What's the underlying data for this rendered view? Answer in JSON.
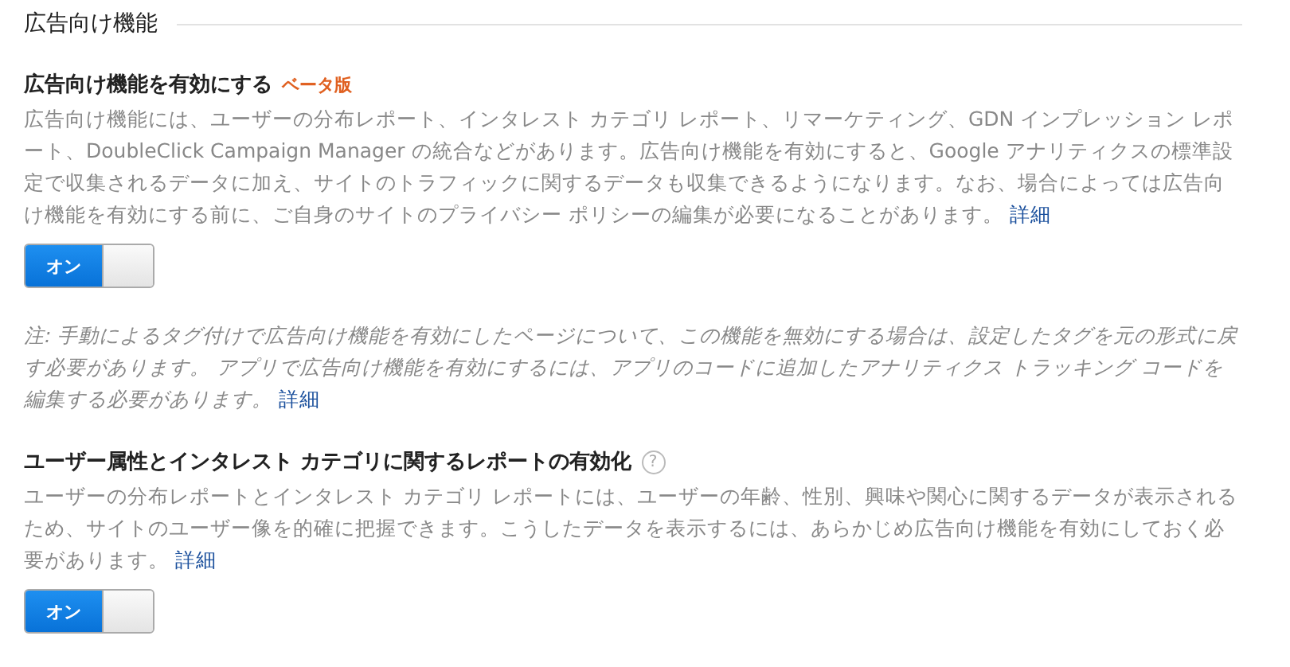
{
  "section": {
    "title": "広告向け機能"
  },
  "items": [
    {
      "kind": "setting",
      "title": "広告向け機能を有効にする",
      "badge": "ベータ版",
      "description": "広告向け機能には、ユーザーの分布レポート、インタレスト カテゴリ レポート、リマーケティング、GDN インプレッション レポート、DoubleClick Campaign Manager の統合などがあります。広告向け機能を有効にすると、Google アナリティクスの標準設定で収集されるデータに加え、サイトのトラフィックに関するデータも収集できるようになります。なお、場合によっては広告向け機能を有効にする前に、ご自身のサイトのプライバシー ポリシーの編集が必要になることがあります。",
      "link": "詳細",
      "toggle": {
        "label": "オン",
        "on": true
      }
    },
    {
      "kind": "note",
      "description": "注: 手動によるタグ付けで広告向け機能を有効にしたページについて、この機能を無効にする場合は、設定したタグを元の形式に戻す必要があります。 アプリで広告向け機能を有効にするには、アプリのコードに追加したアナリティクス トラッキング コードを編集する必要があります。",
      "link": "詳細"
    },
    {
      "kind": "setting",
      "title": "ユーザー属性とインタレスト カテゴリに関するレポートの有効化",
      "help": "?",
      "description": "ユーザーの分布レポートとインタレスト カテゴリ レポートには、ユーザーの年齢、性別、興味や関心に関するデータが表示されるため、サイトのユーザー像を的確に把握できます。こうしたデータを表示するには、あらかじめ広告向け機能を有効にしておく必要があります。",
      "link": "詳細",
      "toggle": {
        "label": "オン",
        "on": true
      }
    }
  ]
}
